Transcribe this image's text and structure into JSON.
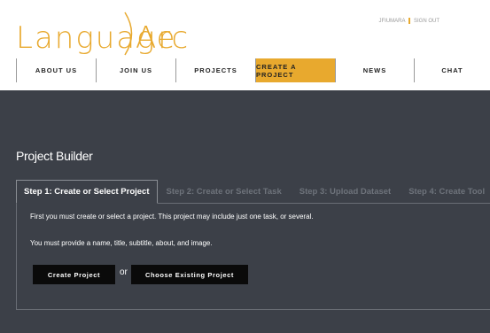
{
  "logo": {
    "part1": "Language",
    "part2": "Arc"
  },
  "user": {
    "username": "JFIUMARA",
    "signout": "SIGN OUT"
  },
  "nav": {
    "items": [
      {
        "label": "ABOUT US"
      },
      {
        "label": "JOIN US"
      },
      {
        "label": "PROJECTS"
      },
      {
        "label": "CREATE A PROJECT"
      },
      {
        "label": "NEWS"
      },
      {
        "label": "CHAT"
      }
    ],
    "active_index": 3
  },
  "page": {
    "title": "Project Builder"
  },
  "tabs": [
    {
      "label": "Step 1: Create or Select Project"
    },
    {
      "label": "Step 2: Create or Select Task"
    },
    {
      "label": "Step 3: Upload Dataset"
    },
    {
      "label": "Step 4: Create Tool"
    }
  ],
  "content": {
    "line1": "First you must create or select a project. This project may include just one task, or several.",
    "line2": "You must provide a name, title, subtitle, about, and image.",
    "create_button": "Create Project",
    "or": "or",
    "choose_button": "Choose Existing Project"
  },
  "colors": {
    "accent": "#e8a92e",
    "background": "#3c4048"
  }
}
